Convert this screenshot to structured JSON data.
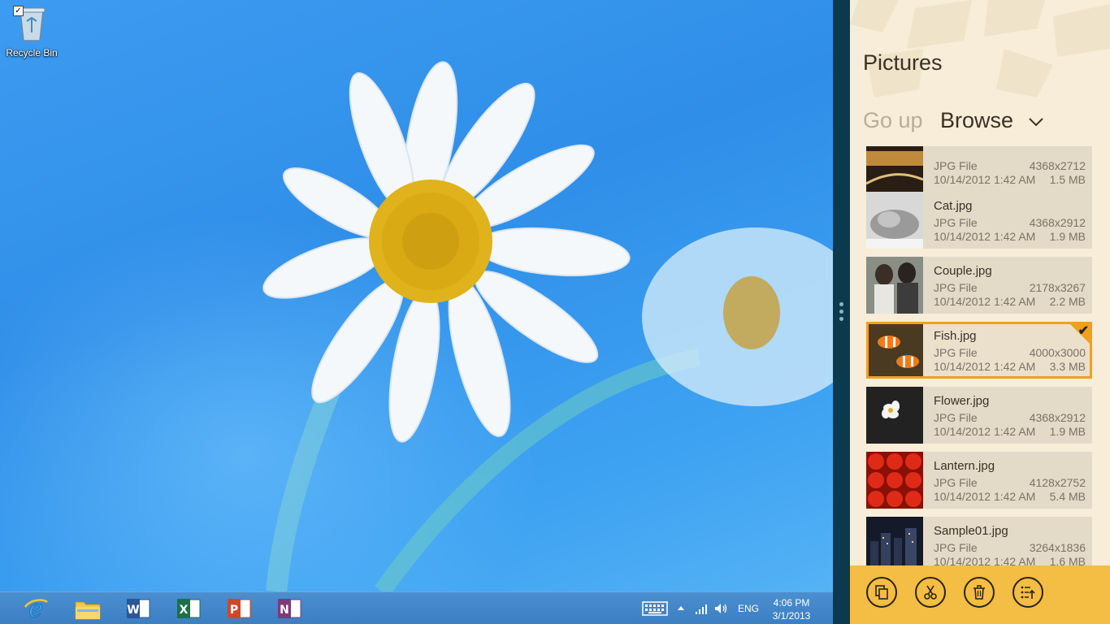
{
  "desktop": {
    "icons": [
      {
        "label": "Recycle Bin",
        "icon": "recycle-bin-icon",
        "checked": true
      }
    ]
  },
  "taskbar": {
    "apps": [
      {
        "name": "Internet Explorer",
        "icon": "internet-explorer-icon"
      },
      {
        "name": "File Explorer",
        "icon": "folder-icon"
      },
      {
        "name": "Word",
        "icon": "word-icon",
        "letter": "W",
        "color": "#2b5797"
      },
      {
        "name": "Excel",
        "icon": "excel-icon",
        "letter": "X",
        "color": "#1e7145"
      },
      {
        "name": "PowerPoint",
        "icon": "powerpoint-icon",
        "letter": "P",
        "color": "#d24726"
      },
      {
        "name": "OneNote",
        "icon": "onenote-icon",
        "letter": "N",
        "color": "#80397b"
      }
    ],
    "tray": {
      "language": "ENG",
      "time": "4:06 PM",
      "date": "3/1/2013"
    }
  },
  "app": {
    "title": "Pictures",
    "go_up_label": "Go up",
    "browse_label": "Browse",
    "accent": "#f0a020",
    "items": [
      {
        "name": "",
        "type": "JPG File",
        "date": "10/14/2012 1:42 AM",
        "dims": "4368x2712",
        "size": "1.5 MB",
        "selected": false
      },
      {
        "name": "Cat.jpg",
        "type": "JPG File",
        "date": "10/14/2012 1:42 AM",
        "dims": "4368x2912",
        "size": "1.9 MB",
        "selected": false
      },
      {
        "name": "Couple.jpg",
        "type": "JPG File",
        "date": "10/14/2012 1:42 AM",
        "dims": "2178x3267",
        "size": "2.2 MB",
        "selected": false
      },
      {
        "name": "Fish.jpg",
        "type": "JPG File",
        "date": "10/14/2012 1:42 AM",
        "dims": "4000x3000",
        "size": "3.3 MB",
        "selected": true
      },
      {
        "name": "Flower.jpg",
        "type": "JPG File",
        "date": "10/14/2012 1:42 AM",
        "dims": "4368x2912",
        "size": "1.9 MB",
        "selected": false
      },
      {
        "name": "Lantern.jpg",
        "type": "JPG File",
        "date": "10/14/2012 1:42 AM",
        "dims": "4128x2752",
        "size": "5.4 MB",
        "selected": false
      },
      {
        "name": "Sample01.jpg",
        "type": "JPG File",
        "date": "10/14/2012 1:42 AM",
        "dims": "3264x1836",
        "size": "1.6 MB",
        "selected": false
      }
    ],
    "app_bar": [
      {
        "icon": "copy-icon"
      },
      {
        "icon": "cut-icon"
      },
      {
        "icon": "delete-icon"
      },
      {
        "icon": "select-list-icon"
      }
    ]
  }
}
